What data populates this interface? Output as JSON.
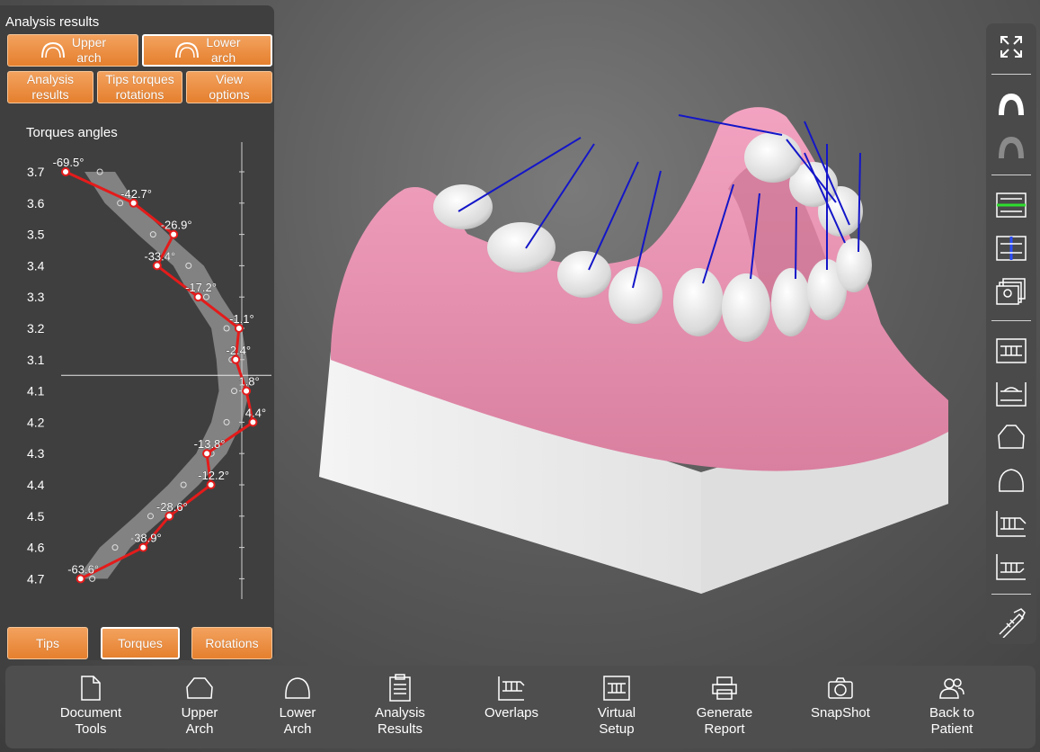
{
  "panel": {
    "title": "Analysis results",
    "upper_arch": "Upper\narch",
    "lower_arch": "Lower\narch",
    "analysis_results": "Analysis\nresults",
    "tips_torques": "Tips torques\nrotations",
    "view_options": "View\noptions",
    "chart_title": "Torques angles",
    "tab_tips": "Tips",
    "tab_torques": "Torques",
    "tab_rotations": "Rotations",
    "selected_tab": "Torques"
  },
  "chart_data": {
    "type": "line",
    "title": "Torques angles",
    "orientation": "vertical",
    "categories": [
      "3.7",
      "3.6",
      "3.5",
      "3.4",
      "3.3",
      "3.2",
      "3.1",
      "4.1",
      "4.2",
      "4.3",
      "4.4",
      "4.5",
      "4.6",
      "4.7"
    ],
    "series": [
      {
        "values": [
          -69.5,
          -42.7,
          -26.9,
          -33.4,
          -17.2,
          -1.1,
          -2.4,
          1.8,
          4.4,
          -13.8,
          -12.2,
          -28.6,
          -38.9,
          -63.6
        ],
        "labels": [
          "-69.5°",
          "-42.7°",
          "-26.9°",
          "-33.4°",
          "-17.2°",
          "-1.1°",
          "-2.4°",
          "1.8°",
          "4.4°",
          "-13.8°",
          "-12.2°",
          "-28.6°",
          "-38.9°",
          "-63.6°"
        ],
        "color": "#e41b1b"
      }
    ],
    "reference_values": [
      -56,
      -48,
      -35,
      -21,
      -14,
      -6,
      -4,
      -3,
      -6,
      -12,
      -23,
      -36,
      -50,
      -59
    ],
    "band_color": "#8e8e8e",
    "x_range": [
      -80,
      20
    ]
  },
  "toolbar_right": {
    "icons": [
      "fullscreen-icon",
      "upper-arch-icon",
      "lower-arch-icon",
      "occlusal-plane-icon",
      "midline-icon",
      "gallery-icon",
      "front-view-icon",
      "back-view-icon",
      "upper-outline-icon",
      "lower-outline-icon",
      "side-left-icon",
      "side-right-icon",
      "caliper-icon"
    ]
  },
  "bottom": {
    "items": [
      {
        "label": "Document\nTools",
        "icon": "document-icon"
      },
      {
        "label": "Upper\nArch",
        "icon": "upper-arch-icon"
      },
      {
        "label": "Lower\nArch",
        "icon": "lower-arch-icon"
      },
      {
        "label": "Analysis\nResults",
        "icon": "clipboard-icon"
      },
      {
        "label": "Overlaps",
        "icon": "overlaps-icon"
      },
      {
        "label": "Virtual\nSetup",
        "icon": "virtual-setup-icon"
      },
      {
        "label": "Generate\nReport",
        "icon": "printer-icon"
      },
      {
        "label": "SnapShot",
        "icon": "camera-icon"
      },
      {
        "label": "Back to\nPatient",
        "icon": "patient-icon"
      }
    ]
  },
  "colors": {
    "accent": "#ec8c3c",
    "gum": "#e98fb0",
    "base": "#dcdcdc",
    "lines": "#1416c8"
  }
}
